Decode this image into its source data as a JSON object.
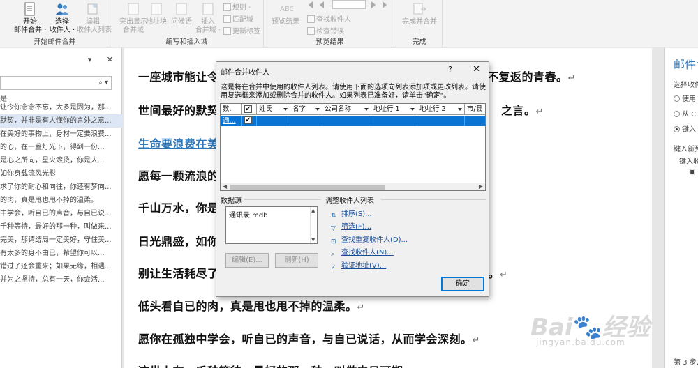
{
  "ribbon": {
    "groups": {
      "start": "开始邮件合并",
      "write": "编写和插入域",
      "preview": "预览结果",
      "finish": "完成"
    },
    "buttons": {
      "start_merge": "开始\n邮件合并 ·",
      "select_recipients": "选择\n收件人 ·",
      "edit_list": "编辑\n收件人列表",
      "highlight": "突出显示\n合并域",
      "address_block": "地址块",
      "greeting": "问候语",
      "insert_field": "插入\n合并域 ·",
      "rules": "规则 ·",
      "match_fields": "匹配域",
      "update_labels": "更新标签",
      "preview_results": "预览结果",
      "find_recipient": "查找收件人",
      "check_errors": "检查错误",
      "finish_merge": "完成并合并\n·"
    }
  },
  "navpane": {
    "items": [
      "让今你念念不忘，大多是因为，那...",
      "默契，并非是有人懂你的言外之意...",
      "在美好的事物上，身材一定要浪费...",
      "的心，在一盏灯光下，得到一份...",
      "是心之所向，星火滚烫，你是人...",
      "如你身载流风光影",
      "求了你的耐心和向往，你还有梦向...",
      "的肉，真是甩也甩不掉的温柔。",
      "中学会，听自已的声音，与自已说...",
      "千种等待，最好的那一种，叫做来...",
      "完美，那请结局一定美好，守住美...",
      "有太多的身不由已，希望你可以...",
      "错过了还会重来；如果无缘，相遇...",
      "并为之坚持，总有一天，你会活..."
    ],
    "selected_index": 1
  },
  "document": {
    "paragraphs": [
      "一座城市能让令",
      "世间最好的默契",
      "生命要浪费在美",
      "愿每一颗流浪的",
      "千山万水，你是",
      "日光鼎盛，如你",
      "别让生活耗尽了",
      "低头看自已的肉，真是甩也甩不掉的温柔。",
      "愿你在孤独中学会，听自已的声音，与自已说话，从而学会深刻。",
      "这世上有，千种等待，最好的那一种，叫做来日可期。"
    ],
    "tails": [
      "不复返的青春。",
      "之言。",
      "",
      "",
      "",
      "",
      "度。"
    ],
    "para_mark": "↵"
  },
  "taskpane": {
    "title": "邮件合",
    "select_label": "选择收件",
    "opt1": "使用",
    "opt2": "从 C",
    "opt3": "键入",
    "type_new": "键入新列",
    "type_recv": "键入收",
    "step": "第 3 步,"
  },
  "dialog": {
    "title": "邮件合并收件人",
    "help": "?",
    "close": "✕",
    "description": "这是将在合并中使用的收件人列表。请使用下面的选项向列表添加项或更改列表。请使用复选框来添加或删除合并的收件人。如果列表已准备好，请单击\"确定\"。",
    "columns": [
      "数.",
      "",
      "姓氏",
      "名字",
      "公司名称",
      "地址行 1",
      "地址行 2",
      "市/县"
    ],
    "row": {
      "source": "通...",
      "checked": "✔"
    },
    "data_source_label": "数据源",
    "data_source_item": "通讯录.mdb",
    "edit_button": "编辑(E)...",
    "refresh_button": "刷新(H)",
    "refine_label": "调整收件人列表",
    "refine_links": [
      "排序(S)...",
      "筛选(F)...",
      "查找重复收件人(D)...",
      "查找收件人(N)...",
      "验证地址(V)..."
    ],
    "ok_button": "确定"
  },
  "watermark": {
    "brand": "Bai 经验",
    "url": "jingyan.baidu.com"
  }
}
